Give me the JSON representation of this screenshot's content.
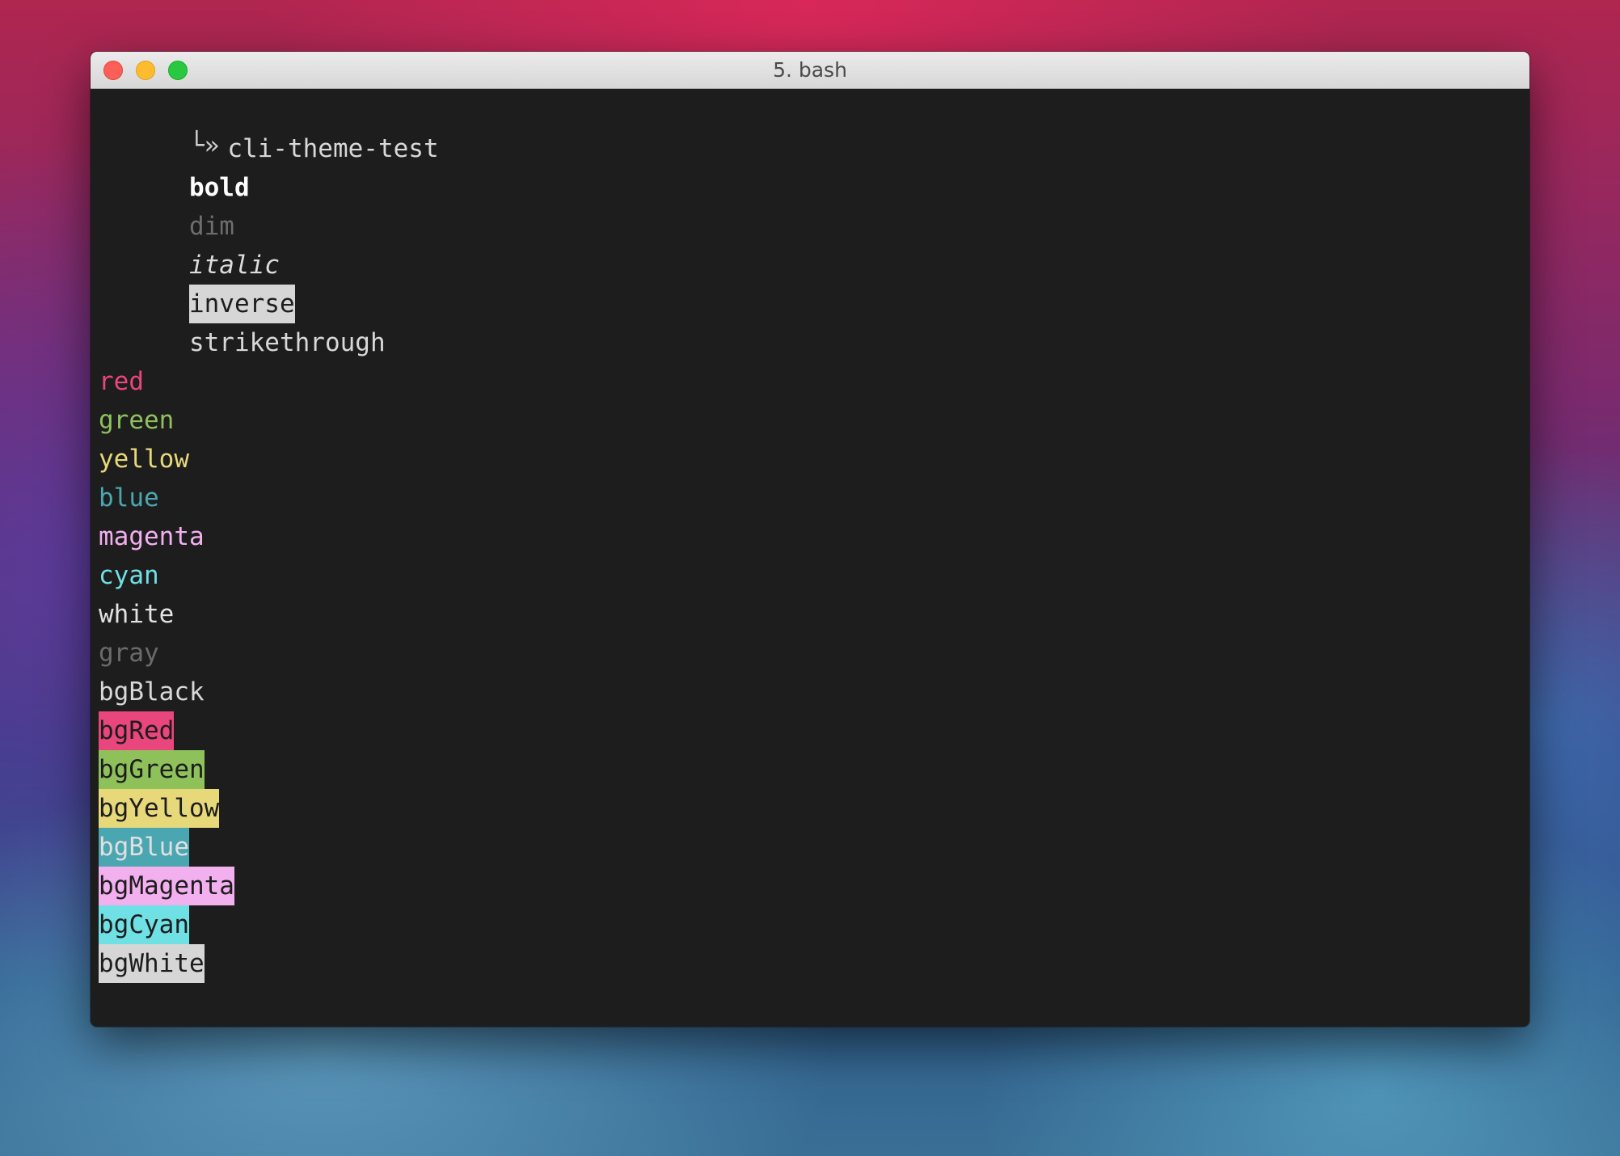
{
  "window": {
    "title": "5. bash"
  },
  "terminal": {
    "prompt": {
      "glyph": "└»",
      "command": "cli-theme-test"
    },
    "styles": {
      "bold": "bold",
      "dim": "dim",
      "italic": "italic",
      "inverse": "inverse",
      "strikethrough": "strikethrough"
    },
    "colors": [
      {
        "label": "red",
        "color": "#e8467c"
      },
      {
        "label": "green",
        "color": "#8fc15b"
      },
      {
        "label": "yellow",
        "color": "#e7d97a"
      },
      {
        "label": "blue",
        "color": "#4aa6b0"
      },
      {
        "label": "magenta",
        "color": "#f2b0ef"
      },
      {
        "label": "cyan",
        "color": "#6fe0e4"
      },
      {
        "label": "white",
        "color": "#e2e2e2"
      },
      {
        "label": "gray",
        "color": "#6b6b6b"
      }
    ],
    "backgrounds": [
      {
        "label": "bgBlack",
        "bg": "transparent",
        "fg": "#d8d8d8"
      },
      {
        "label": "bgRed",
        "bg": "#e8467c",
        "fg": "#1d1d1e"
      },
      {
        "label": "bgGreen",
        "bg": "#8fc15b",
        "fg": "#1d1d1e"
      },
      {
        "label": "bgYellow",
        "bg": "#e7d97a",
        "fg": "#1d1d1e"
      },
      {
        "label": "bgBlue",
        "bg": "#4aa6b0",
        "fg": "#e0e0e0"
      },
      {
        "label": "bgMagenta",
        "bg": "#f2b0ef",
        "fg": "#1d1d1e"
      },
      {
        "label": "bgCyan",
        "bg": "#6fe0e4",
        "fg": "#1d1d1e"
      },
      {
        "label": "bgWhite",
        "bg": "#d6d6d6",
        "fg": "#1d1d1e"
      }
    ]
  }
}
